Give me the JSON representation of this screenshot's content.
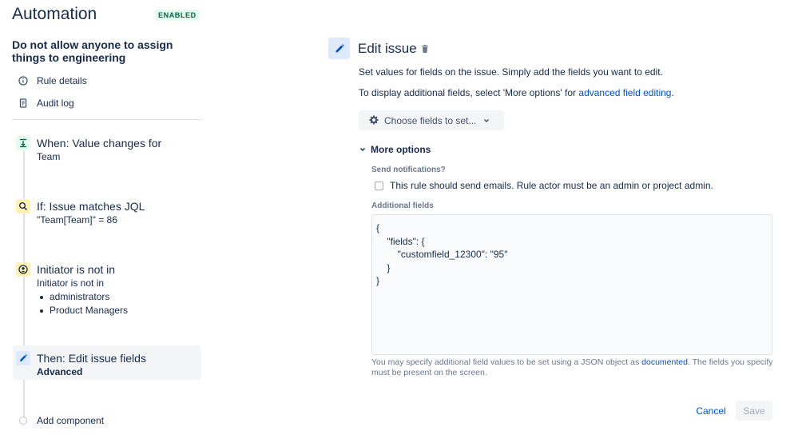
{
  "app": {
    "title": "Automation",
    "status_badge": "ENABLED"
  },
  "rule": {
    "name": "Do not allow anyone to assign things to engineering"
  },
  "nav": [
    {
      "label": "Rule details",
      "icon": "info-icon"
    },
    {
      "label": "Audit log",
      "icon": "document-icon"
    }
  ],
  "steps": {
    "trigger": {
      "title": "When: Value changes for",
      "subtitle": "Team",
      "icon": "value-change-icon",
      "color": "#e3fcef"
    },
    "condition": {
      "title": "If: Issue matches JQL",
      "subtitle": "\"Team[Team]\" = 86",
      "icon": "search-icon",
      "color": "#fff0b3"
    },
    "initiator": {
      "title": "Initiator is not in",
      "subtitle": "Initiator is not in",
      "items": [
        "administrators",
        "Product Managers"
      ],
      "icon": "user-group-icon",
      "color": "#fff0b3"
    },
    "action": {
      "title": "Then: Edit issue fields",
      "subtitle": "Advanced",
      "icon": "pencil-icon",
      "color": "#deebff"
    }
  },
  "add_component": {
    "label": "Add component"
  },
  "panel": {
    "title": "Edit issue",
    "description": "Set values for fields on the issue. Simply add the fields you want to edit.",
    "additional_info_prefix": "To display additional fields, select 'More options' for ",
    "additional_info_link": "advanced field editing",
    "additional_info_suffix": ".",
    "choose_fields_button": "Choose fields to set...",
    "more_options": "More options",
    "send_notifications_label": "Send notifications?",
    "send_notifications_checkbox": "This rule should send emails. Rule actor must be an admin or project admin.",
    "send_notifications_checked": false,
    "additional_fields_label": "Additional fields",
    "additional_fields_value": "{\n    \"fields\": {\n        \"customfield_12300\": \"95\"\n    }\n}",
    "help_prefix": "You may specify additional field values to be set using a JSON object as ",
    "help_link": "documented",
    "help_suffix": ". The fields you specify must be present on the screen.",
    "cancel_button": "Cancel",
    "save_button": "Save"
  },
  "colors": {
    "accent": "#0052cc",
    "text": "#172b4d",
    "badge_bg": "#e3fcef",
    "badge_text": "#006644"
  }
}
